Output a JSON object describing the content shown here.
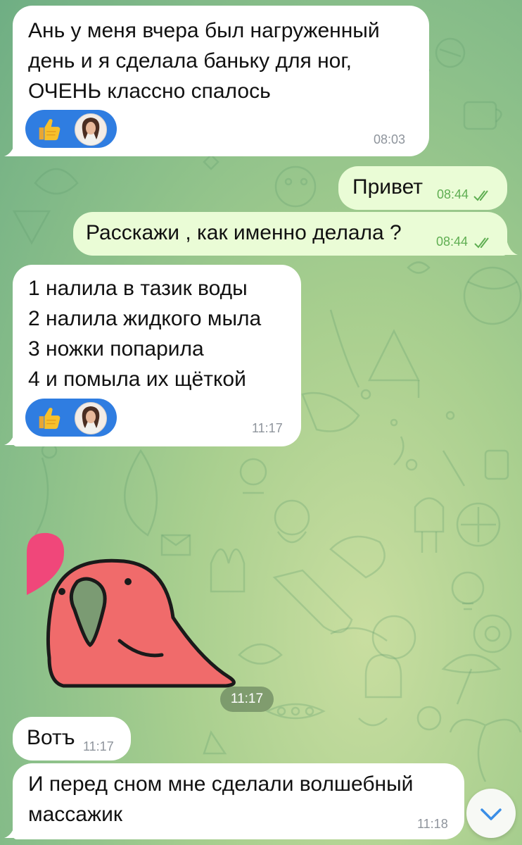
{
  "messages": [
    {
      "id": "m1",
      "direction": "in",
      "text": "Ань у меня вчера был нагруженный\nдень и я сделала баньку для ног,\nОЧЕНЬ классно спалось",
      "time": "08:03",
      "reactions": [
        "thumbs-up"
      ]
    },
    {
      "id": "m2",
      "direction": "out",
      "text": "Привет",
      "time": "08:44",
      "status": "read"
    },
    {
      "id": "m3",
      "direction": "out",
      "text": "Расскажи , как именно делала ?",
      "time": "08:44",
      "status": "read"
    },
    {
      "id": "m4",
      "direction": "in",
      "text": "1 налила в тазик воды\n2 налила жидкого мыла\n3 ножки попарила\n4 и помыла их щёткой",
      "time": "11:17",
      "reactions": [
        "thumbs-up"
      ]
    },
    {
      "id": "m5",
      "direction": "in",
      "type": "sticker",
      "sticker": "parrot-heart-sticker",
      "time": "11:17"
    },
    {
      "id": "m6",
      "direction": "in",
      "text": "Вотъ",
      "time": "11:17"
    },
    {
      "id": "m7",
      "direction": "in",
      "text": "И перед сном мне сделали волшебный\nмассажик",
      "time": "11:18"
    }
  ],
  "colors": {
    "incoming_bubble": "#ffffff",
    "outgoing_bubble": "#eafcd6",
    "reaction_pill": "#2f7de1",
    "read_check": "#5fae52"
  },
  "icons": {
    "reaction": "thumbs-up-icon",
    "scroll": "chevron-down-icon",
    "read": "double-check-icon"
  }
}
